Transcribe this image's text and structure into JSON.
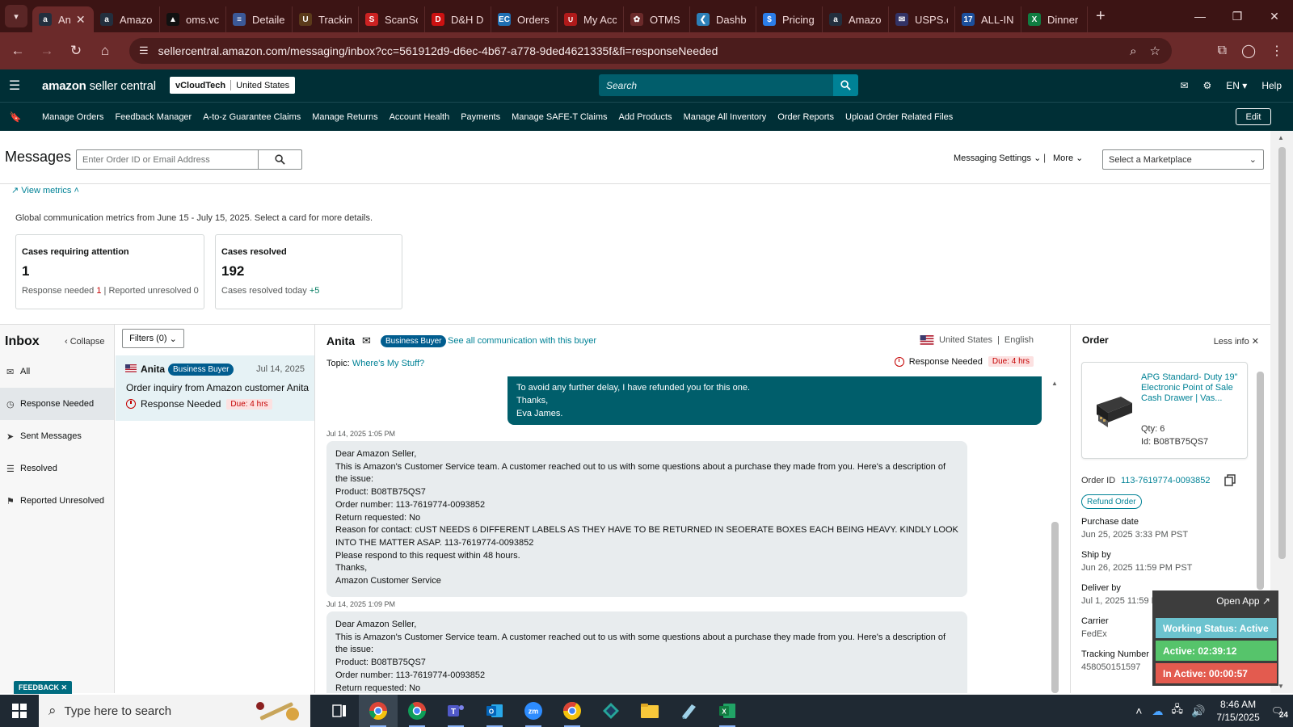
{
  "browser": {
    "tabs": [
      {
        "title": "An",
        "fav_color": "#232f3e",
        "fav_glyph": "a",
        "active": true
      },
      {
        "title": "Amazo",
        "fav_color": "#232f3e",
        "fav_glyph": "a"
      },
      {
        "title": "oms.vc",
        "fav_color": "#111111",
        "fav_glyph": "▲"
      },
      {
        "title": "Detaile",
        "fav_color": "#3b5998",
        "fav_glyph": "≡"
      },
      {
        "title": "Trackin",
        "fav_color": "#5b3a1a",
        "fav_glyph": "U"
      },
      {
        "title": "ScanSc",
        "fav_color": "#cc2222",
        "fav_glyph": "S"
      },
      {
        "title": "D&H D",
        "fav_color": "#cc1111",
        "fav_glyph": "D"
      },
      {
        "title": "Orders",
        "fav_color": "#1f6fb2",
        "fav_glyph": "EC"
      },
      {
        "title": "My Acc",
        "fav_color": "#b01a1a",
        "fav_glyph": "∪"
      },
      {
        "title": "OTMS",
        "fav_color": "#6b2a2a",
        "fav_glyph": "✿"
      },
      {
        "title": "Dashb",
        "fav_color": "#2c7fb8",
        "fav_glyph": "❮"
      },
      {
        "title": "Pricing",
        "fav_color": "#2b7de9",
        "fav_glyph": "$"
      },
      {
        "title": "Amazo",
        "fav_color": "#232f3e",
        "fav_glyph": "a"
      },
      {
        "title": "USPS.c",
        "fav_color": "#333366",
        "fav_glyph": "✉"
      },
      {
        "title": "ALL-IN",
        "fav_color": "#1b4f9c",
        "fav_glyph": "17"
      },
      {
        "title": "Dinner",
        "fav_color": "#107c41",
        "fav_glyph": "X"
      }
    ],
    "url": "sellercentral.amazon.com/messaging/inbox?cc=561912d9-d6ec-4b67-a778-9ded4621335f&fi=responseNeeded"
  },
  "header": {
    "logo_amazon": "amazon",
    "logo_rest": " seller central",
    "account": "vCloudTech",
    "region": "United States",
    "search_placeholder": "Search",
    "lang": "EN",
    "help": "Help"
  },
  "navbar": {
    "links": [
      "Manage Orders",
      "Feedback Manager",
      "A-to-z Guarantee Claims",
      "Manage Returns",
      "Account Health",
      "Payments",
      "Manage SAFE-T Claims",
      "Add Products",
      "Manage All Inventory",
      "Order Reports",
      "Upload Order Related Files"
    ],
    "edit": "Edit"
  },
  "messages": {
    "title": "Messages",
    "search_placeholder": "Enter Order ID or Email Address",
    "settings": "Messaging Settings",
    "more": "More",
    "marketplace_placeholder": "Select a Marketplace"
  },
  "metrics": {
    "toggle": "View metrics",
    "description": "Global communication metrics from June 15 - July 15, 2025. Select a card for more details.",
    "cards": [
      {
        "title": "Cases requiring attention",
        "value": "1",
        "sub1_label": "Response needed",
        "sub1_value": "1",
        "sub2_label": "Reported unresolved",
        "sub2_value": "0"
      },
      {
        "title": "Cases resolved",
        "value": "192",
        "sub1_label": "Cases resolved today",
        "sub1_value": "+5"
      }
    ]
  },
  "inbox": {
    "title": "Inbox",
    "collapse": "Collapse",
    "nav": [
      {
        "label": "All",
        "icon": "mail-icon"
      },
      {
        "label": "Response Needed",
        "icon": "clock-icon",
        "selected": true
      },
      {
        "label": "Sent Messages",
        "icon": "send-icon"
      },
      {
        "label": "Resolved",
        "icon": "resolved-icon"
      },
      {
        "label": "Reported Unresolved",
        "icon": "reported-icon"
      }
    ],
    "filters": "Filters (0)",
    "conversation": {
      "name": "Anita",
      "badge": "Business Buyer",
      "date": "Jul 14, 2025",
      "subject": "Order inquiry from Amazon customer Anita",
      "status": "Response Needed",
      "due": "Due: 4 hrs"
    }
  },
  "thread": {
    "buyer": "Anita",
    "badge": "Business Buyer",
    "see_all": "See all communication with this buyer",
    "country": "United States",
    "language": "English",
    "topic_label": "Topic:",
    "topic": "Where's My Stuff?",
    "status": "Response Needed",
    "due": "Due: 4 hrs",
    "sent_lines": [
      "To avoid any further delay, I have refunded you for this one.",
      "Thanks,",
      "Eva James."
    ],
    "messages": [
      {
        "time": "Jul 14, 2025 1:05 PM",
        "lines": [
          "Dear Amazon Seller,",
          "This is Amazon's Customer Service team. A customer reached out to us with some questions about a purchase they made from you. Here's a description of the issue:",
          "Product: B08TB75QS7",
          "Order number: 113-7619774-0093852",
          "Return requested: No",
          "Reason for contact: cUST NEEDS 6 DIFFERENT LABELS AS THEY HAVE TO BE RETURNED IN SEOERATE BOXES EACH BEING HEAVY. KINDLY LOOK INTO THE MATTER ASAP. 113-7619774-0093852",
          "Please respond to this request within 48 hours.",
          "Thanks,",
          "Amazon Customer Service"
        ]
      },
      {
        "time": "Jul 14, 2025 1:09 PM",
        "lines": [
          "Dear Amazon Seller,",
          "This is Amazon's Customer Service team. A customer reached out to us with some questions about a purchase they made from you. Here's a description of the issue:",
          "Product: B08TB75QS7",
          "Order number: 113-7619774-0093852",
          "Return requested: No"
        ]
      }
    ]
  },
  "order": {
    "title": "Order",
    "less_info": "Less info",
    "product_title": "APG Standard- Duty 19\" Electronic Point of Sale Cash Drawer | Vas...",
    "qty": "Qty: 6",
    "asin": "Id: B08TB75QS7",
    "order_id_label": "Order ID",
    "order_id": "113-7619774-0093852",
    "refund": "Refund Order",
    "fields": [
      {
        "label": "Purchase date",
        "value": "Jun 25, 2025 3:33 PM PST"
      },
      {
        "label": "Ship by",
        "value": "Jun 26, 2025 11:59 PM PST"
      },
      {
        "label": "Deliver by",
        "value": "Jul 1, 2025 11:59 PM PST"
      },
      {
        "label": "Carrier",
        "value": "FedEx"
      },
      {
        "label": "Tracking Number",
        "value": "458050151597"
      }
    ]
  },
  "work_status": {
    "open_app": "Open App ↗",
    "status": "Working Status: Active",
    "active": "Active: 02:39:12",
    "inactive": "In Active: 00:00:57",
    "colors": {
      "status": "#6cc3cf",
      "active": "#56c46b",
      "inactive": "#e35b4f"
    }
  },
  "feedback": "FEEDBACK",
  "taskbar": {
    "search_placeholder": "Type here to search",
    "time": "8:46 AM",
    "date": "7/15/2025",
    "notifications": "24"
  }
}
